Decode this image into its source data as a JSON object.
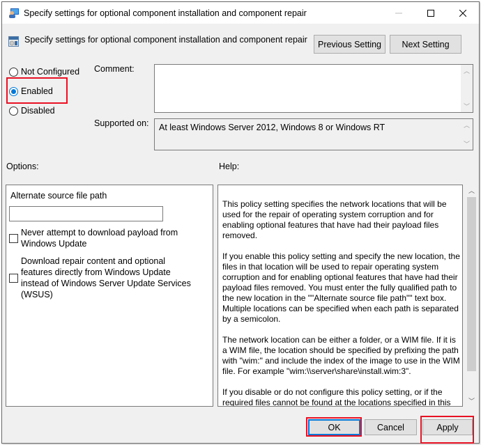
{
  "window": {
    "title": "Specify settings for optional component installation and component repair",
    "controls": {
      "minimize": "—",
      "maximize": "☐",
      "close": "✕"
    }
  },
  "header": {
    "setting_name": "Specify settings for optional component installation and component repair",
    "previous_label": "Previous Setting",
    "next_label": "Next Setting"
  },
  "state": {
    "options": [
      "Not Configured",
      "Enabled",
      "Disabled"
    ],
    "selected": "Enabled"
  },
  "comment": {
    "label": "Comment:",
    "value": ""
  },
  "supported": {
    "label": "Supported on:",
    "value": "At least Windows Server 2012, Windows 8 or Windows RT"
  },
  "options_section": {
    "label": "Options:",
    "alt_path_label": "Alternate source file path",
    "alt_path_value": "",
    "checkboxes": [
      {
        "label": "Never attempt to download payload from Windows Update",
        "checked": false
      },
      {
        "label": "Download repair content and optional features directly from Windows Update instead of Windows Server Update Services (WSUS)",
        "checked": false
      }
    ]
  },
  "help_section": {
    "label": "Help:",
    "paragraphs": [
      "This policy setting specifies the network locations that will be used for the repair of operating system corruption and for enabling optional features that have had their payload files removed.",
      "If you enable this policy setting and specify the new location, the files in that location will be used to repair operating system corruption and for enabling optional features that have had their payload files removed. You must enter the fully qualified path to the new location in the \"\"Alternate source file path\"\" text box. Multiple locations can be specified when each path is separated by a semicolon.",
      "The network location can be either a folder, or a WIM file. If it is a WIM file, the location should be specified by prefixing the path with \"wim:\" and include the index of the image to use in the WIM file. For example \"wim:\\\\server\\share\\install.wim:3\".",
      "If you disable or do not configure this policy setting, or if the required files cannot be found at the locations specified in this"
    ],
    "scroll_position": 0
  },
  "footer": {
    "ok_label": "OK",
    "cancel_label": "Cancel",
    "apply_label": "Apply"
  },
  "colors": {
    "highlight": "#e81123",
    "accent": "#0078d7"
  }
}
